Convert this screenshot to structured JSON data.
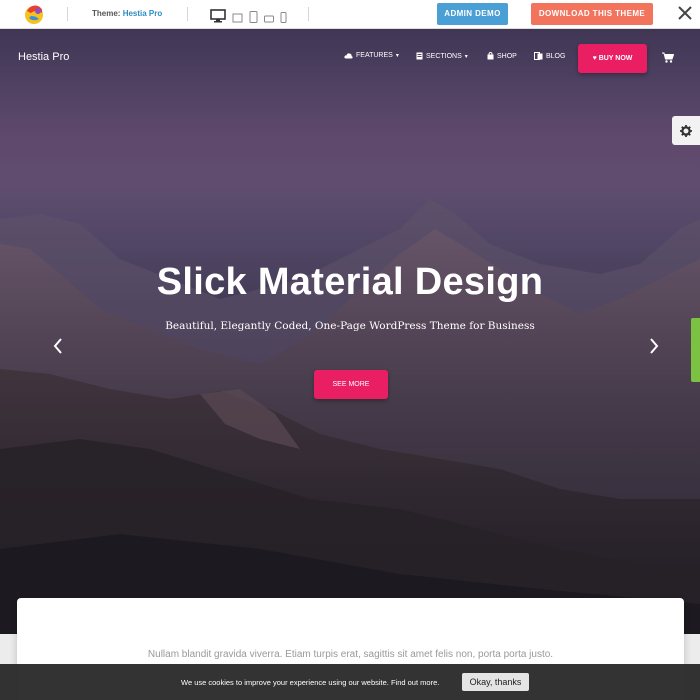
{
  "demo_bar": {
    "theme_prefix": "Theme:",
    "theme_name": "Hestia Pro",
    "devices": [
      "desktop-icon",
      "laptop-icon",
      "tablet-icon",
      "tablet-landscape-icon",
      "phone-icon"
    ],
    "admin_demo": "ADMIN DEMO",
    "download": "DOWNLOAD THIS THEME"
  },
  "nav": {
    "brand": "Hestia Pro",
    "items": [
      {
        "label": "FEATURES",
        "icon": "cloud-icon",
        "dropdown": true
      },
      {
        "label": "SECTIONS",
        "icon": "document-icon",
        "dropdown": true
      },
      {
        "label": "SHOP",
        "icon": "bag-icon",
        "dropdown": false
      },
      {
        "label": "BLOG",
        "icon": "pages-icon",
        "dropdown": false
      }
    ],
    "buy_now": "BUY NOW"
  },
  "hero": {
    "title": "Slick Material Design",
    "subtitle": "Beautiful, Elegantly Coded, One-Page WordPress Theme for Business",
    "cta": "SEE MORE"
  },
  "content": {
    "text": "Nullam blandit gravida viverra. Etiam turpis erat, sagittis sit amet felis non, porta porta justo."
  },
  "cookie": {
    "message": "We use cookies to improve your experience using our website. Find out more.",
    "ok": "Okay, thanks"
  },
  "colors": {
    "accent": "#e91e63",
    "admin_button": "#4a9fd4",
    "download_button": "#f2745d",
    "settings_tab_green": "#7cc242"
  }
}
